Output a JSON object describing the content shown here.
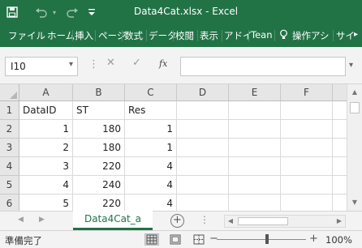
{
  "window": {
    "title": "Data4Cat.xlsx  -  Excel",
    "icons": [
      "save-icon",
      "undo-icon",
      "redo-icon",
      "customize-qat-icon"
    ]
  },
  "ribbon": {
    "tabs": [
      "ファイル",
      "ホーム",
      "挿入",
      "ページ",
      "数式",
      "データ",
      "校閲",
      "表示",
      "アドイ",
      "Tean"
    ],
    "tell_me": "操作アシ",
    "sign_in": "サイ"
  },
  "formula_bar": {
    "name_box": "I10",
    "cancel_icon": "✕",
    "enter_icon": "✓",
    "fx_label": "fx",
    "formula": ""
  },
  "sheet": {
    "columns": [
      "A",
      "B",
      "C",
      "D",
      "E",
      "F"
    ],
    "rows": [
      {
        "row": "1",
        "cells": [
          "DataID",
          "ST",
          "Res",
          "",
          "",
          ""
        ]
      },
      {
        "row": "2",
        "cells": [
          "1",
          "180",
          "1",
          "",
          "",
          ""
        ]
      },
      {
        "row": "3",
        "cells": [
          "2",
          "180",
          "1",
          "",
          "",
          ""
        ]
      },
      {
        "row": "4",
        "cells": [
          "3",
          "220",
          "4",
          "",
          "",
          ""
        ]
      },
      {
        "row": "5",
        "cells": [
          "4",
          "240",
          "4",
          "",
          "",
          ""
        ]
      },
      {
        "row": "6",
        "cells": [
          "5",
          "220",
          "4",
          "",
          "",
          ""
        ]
      }
    ],
    "active_tab": "Data4Cat_a",
    "add_sheet": "⊕"
  },
  "status": {
    "text": "準備完了",
    "zoom": "100%",
    "zoom_minus": "−",
    "zoom_plus": "+"
  },
  "colors": {
    "accent": "#217346",
    "header_bg": "#e6e6e6",
    "grid_line": "#dadada"
  }
}
